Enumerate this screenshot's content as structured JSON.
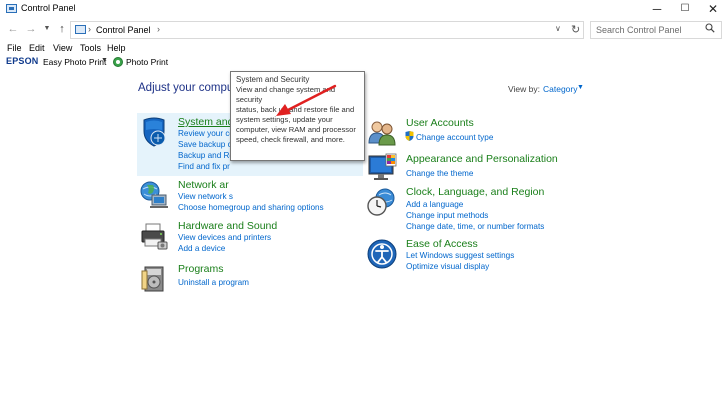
{
  "window": {
    "title": "Control Panel",
    "controls": {
      "minimize": "─",
      "maximize": "☐",
      "close": "✕"
    }
  },
  "address_bar": {
    "breadcrumb": "Control Panel",
    "search_placeholder": "Search Control Panel"
  },
  "menubar": [
    "File",
    "Edit",
    "View",
    "Tools",
    "Help"
  ],
  "epson_toolbar": {
    "logo": "EPSON",
    "easy_photo_print": "Easy Photo Print",
    "photo_print": "Photo Print"
  },
  "main": {
    "title": "Adjust your computer's settings",
    "view_by_label": "View by:",
    "view_by_value": "Category"
  },
  "categories_left": [
    {
      "title": "System and Security",
      "icon": "shield-icon",
      "links": [
        "Review your computer's status",
        "Save backup co",
        "Backup and Re",
        "Find and fix pr"
      ]
    },
    {
      "title": "Network ar",
      "icon": "network-globe-icon",
      "links": [
        "View network s",
        "Choose homegroup and sharing options"
      ]
    },
    {
      "title": "Hardware and Sound",
      "icon": "printer-icon",
      "links": [
        "View devices and printers",
        "Add a device"
      ]
    },
    {
      "title": "Programs",
      "icon": "programs-icon",
      "links": [
        "Uninstall a program"
      ]
    }
  ],
  "categories_right": [
    {
      "title": "User Accounts",
      "icon": "users-icon",
      "links": [
        "Change account type"
      ]
    },
    {
      "title": "Appearance and Personalization",
      "icon": "monitor-palette-icon",
      "links": [
        "Change the theme"
      ]
    },
    {
      "title": "Clock, Language, and Region",
      "icon": "clock-globe-icon",
      "links": [
        "Add a language",
        "Change input methods",
        "Change date, time, or number formats"
      ]
    },
    {
      "title": "Ease of Access",
      "icon": "accessibility-icon",
      "links": [
        "Let Windows suggest settings",
        "Optimize visual display"
      ]
    }
  ],
  "tooltip": {
    "title": "System and Security",
    "lines": [
      "View and change system and security",
      "status, back up and restore file and",
      "system settings, update your",
      "computer, view RAM and processor",
      "speed, check firewall, and more."
    ]
  },
  "colors": {
    "category_title": "#1a7f1a",
    "link": "#0066cc",
    "heading": "#1e3287",
    "highlight": "#e5f3fb",
    "annotation_arrow": "#e02020"
  }
}
